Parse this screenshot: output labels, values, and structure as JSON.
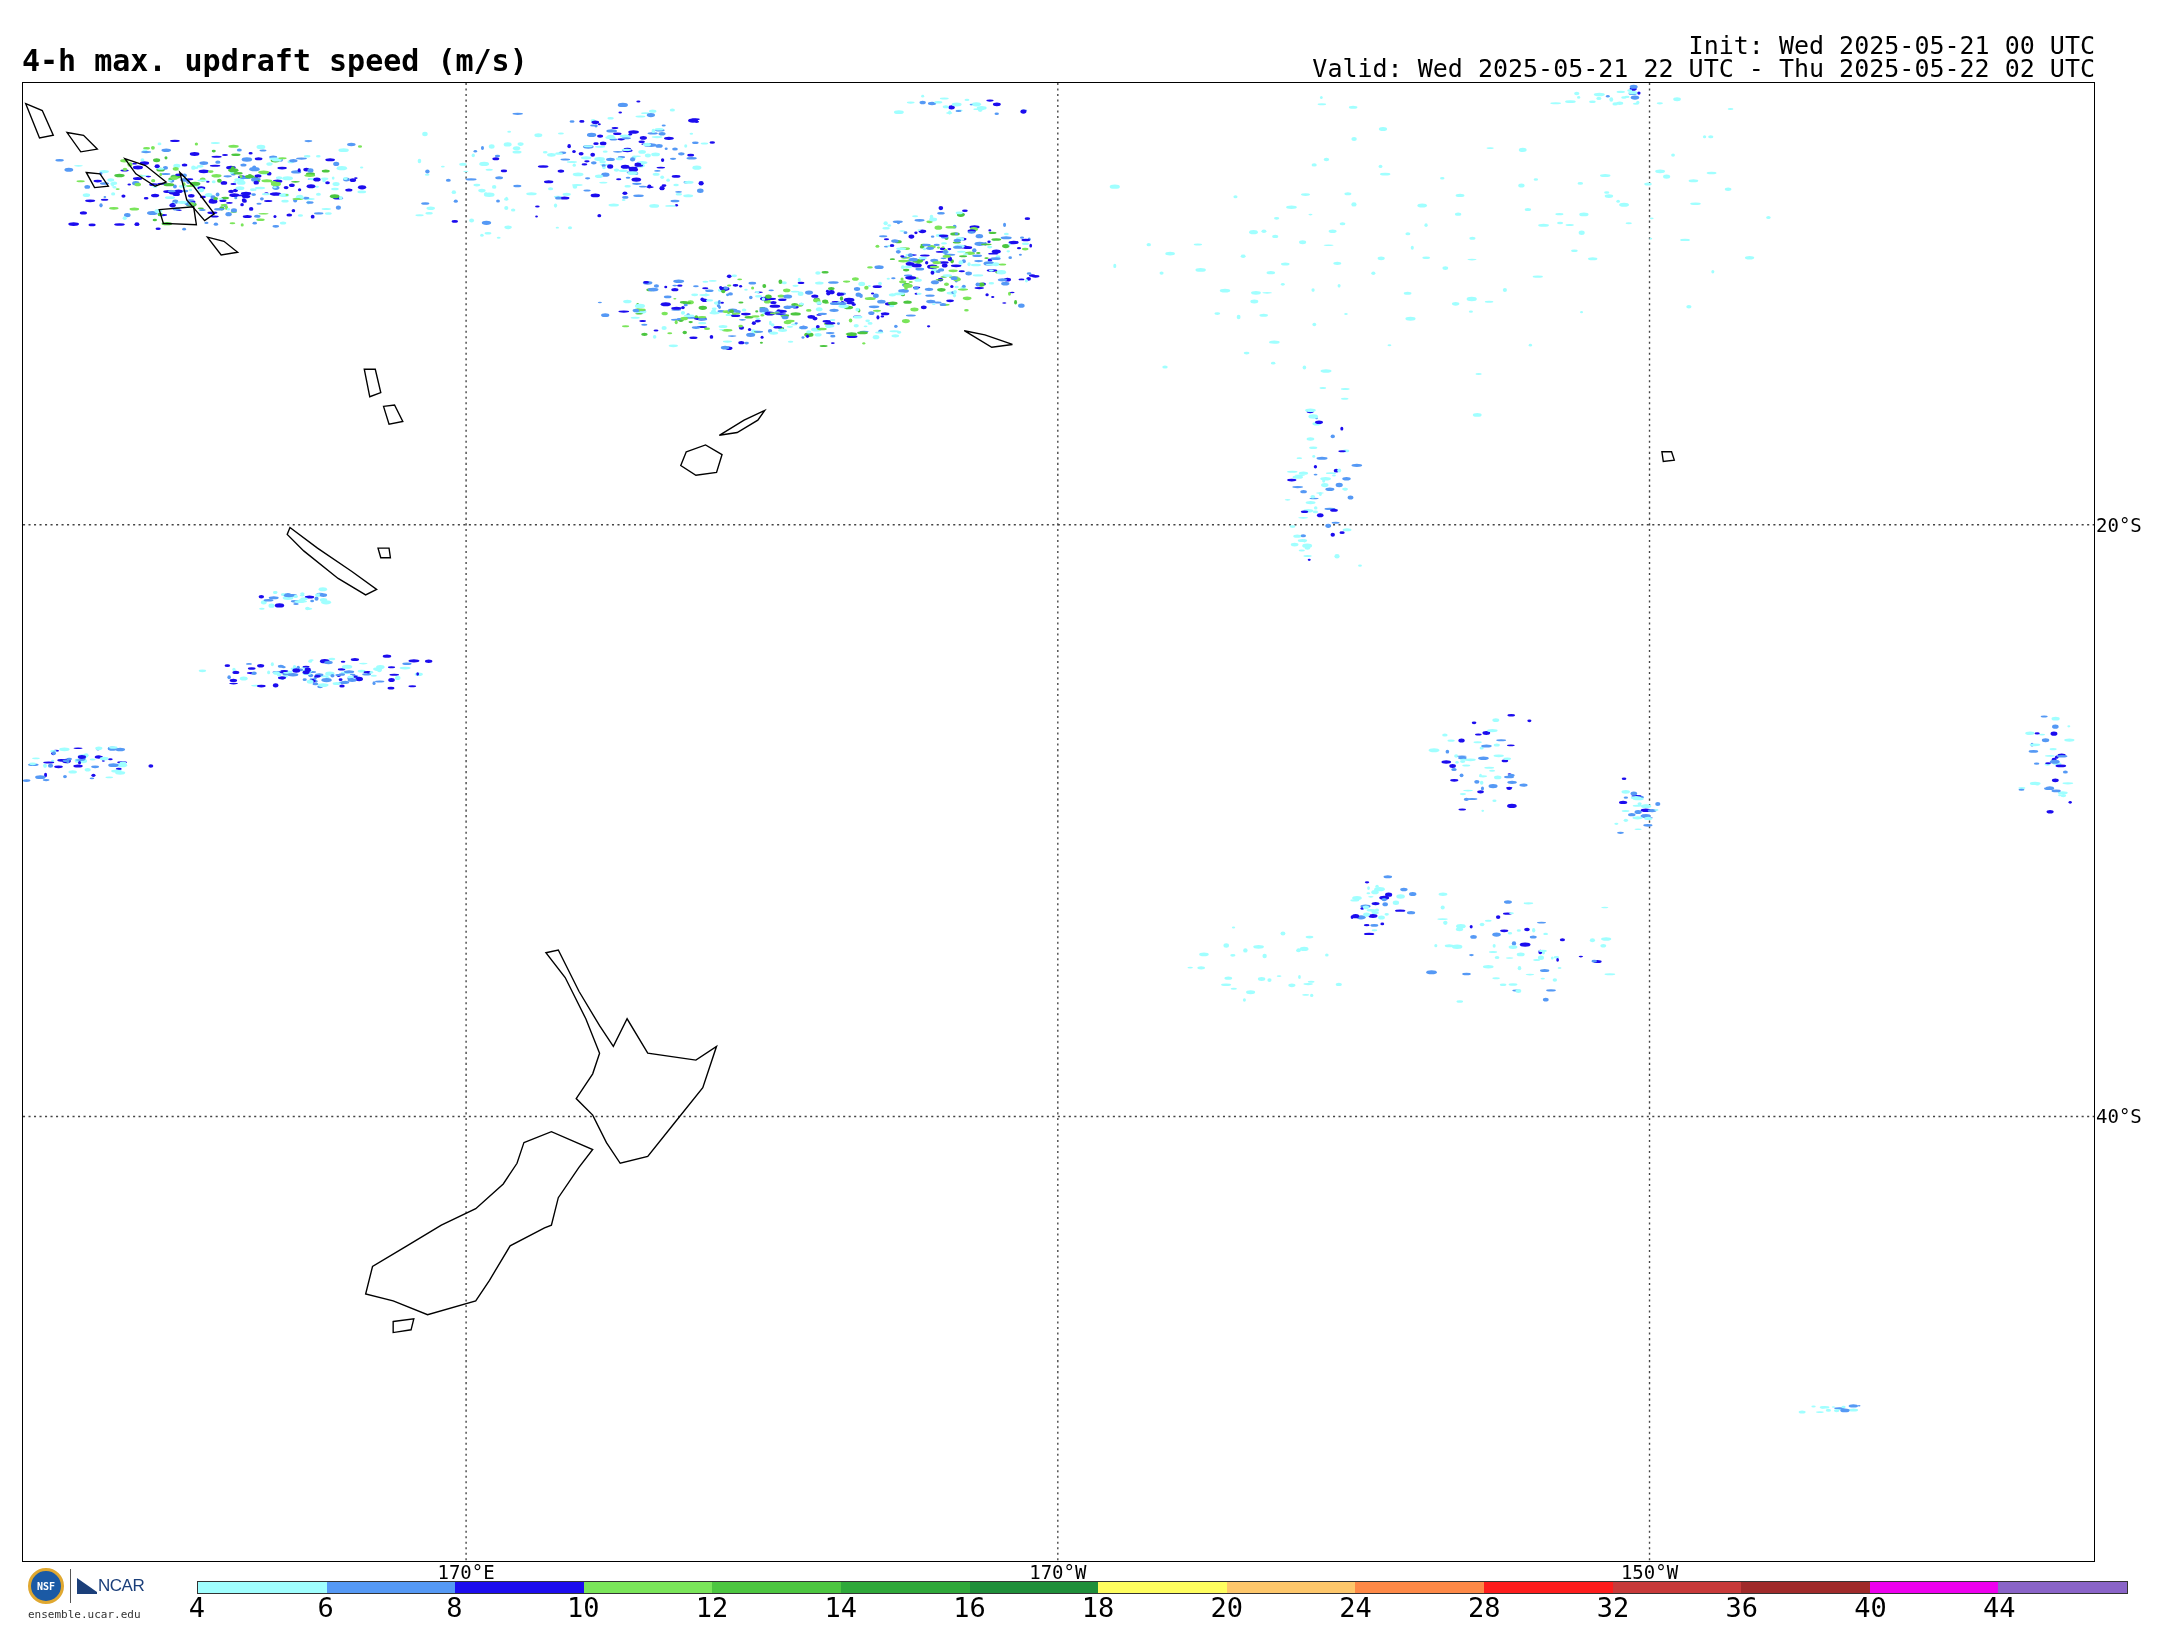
{
  "title": "4-h max. updraft speed (m/s)",
  "init": "Init: Wed 2025-05-21 00 UTC",
  "valid": "Valid: Wed 2025-05-21 22 UTC - Thu 2025-05-22 02 UTC",
  "map": {
    "lat_labels": [
      "20°S",
      "40°S"
    ],
    "lon_labels": [
      "170°E",
      "170°W",
      "150°W"
    ]
  },
  "logo": {
    "nsf": "NSF",
    "ncar": "NCAR",
    "url": "ensemble.ucar.edu"
  },
  "colorbar": {
    "segments": [
      {
        "color": "#a0ffff"
      },
      {
        "color": "#5599f5"
      },
      {
        "color": "#1c0cee"
      },
      {
        "color": "#7ae55a"
      },
      {
        "color": "#4cc640"
      },
      {
        "color": "#2fa83a"
      },
      {
        "color": "#1f8f3a"
      },
      {
        "color": "#fffe5f"
      },
      {
        "color": "#fec76b"
      },
      {
        "color": "#fe8947"
      },
      {
        "color": "#fe1c1c"
      },
      {
        "color": "#c83a3a"
      },
      {
        "color": "#a02a2a"
      },
      {
        "color": "#ee00ee"
      },
      {
        "color": "#8a64c8"
      }
    ],
    "labels": [
      "4",
      "6",
      "8",
      "10",
      "12",
      "14",
      "16",
      "18",
      "20",
      "24",
      "28",
      "32",
      "36",
      "40",
      "44"
    ]
  }
}
